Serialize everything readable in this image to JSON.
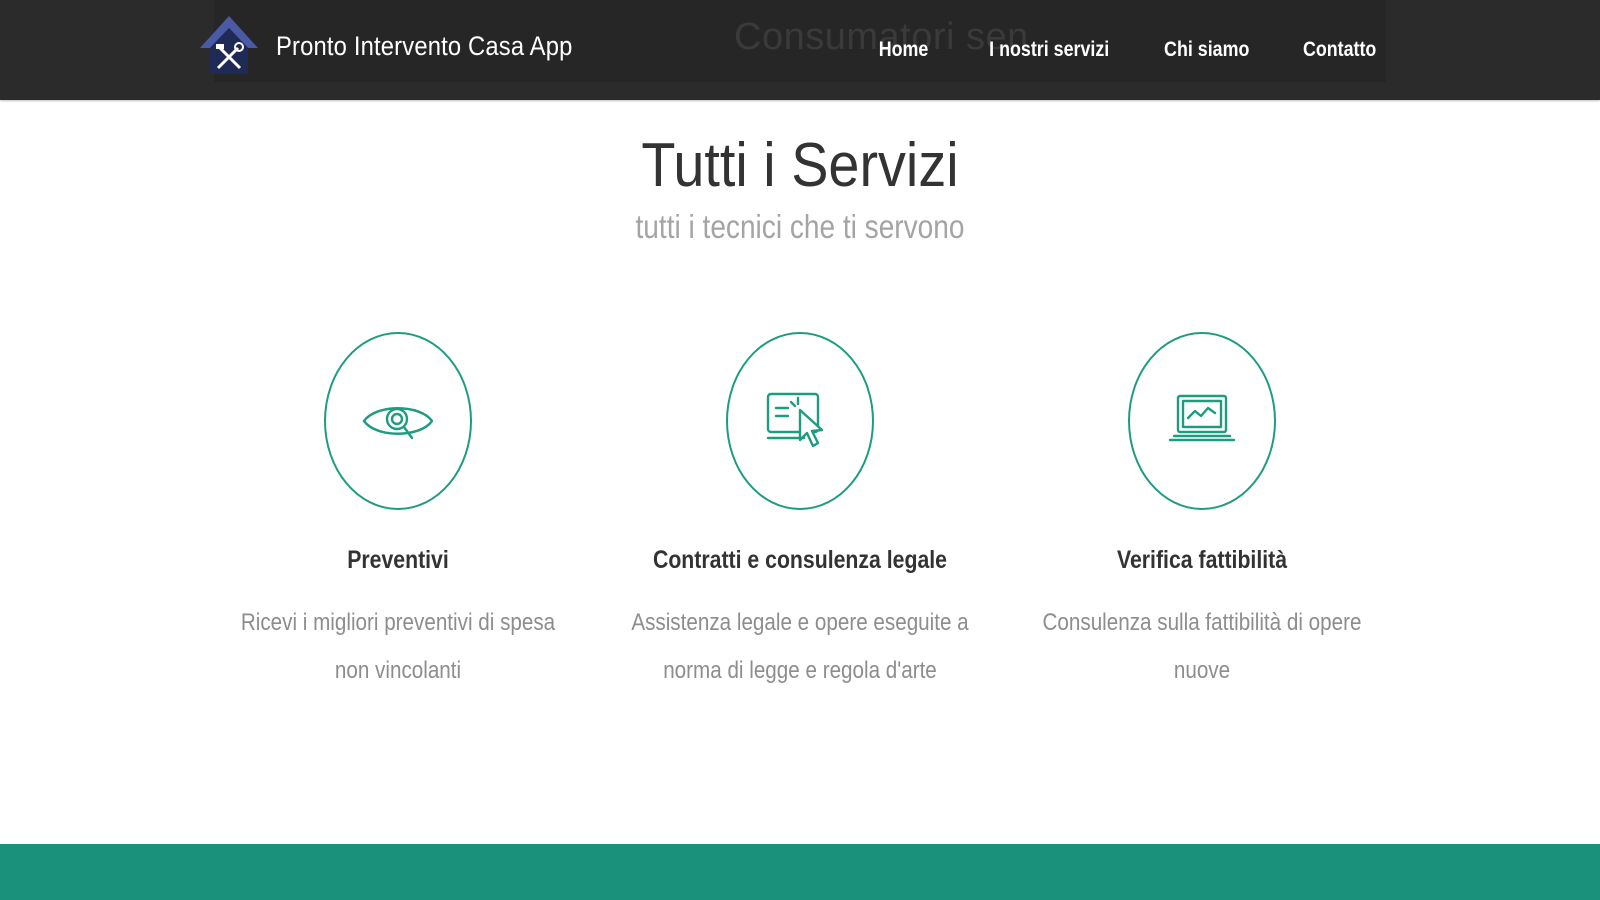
{
  "colors": {
    "navbar_bg": "#2b2b2b",
    "accent": "#1e9c80",
    "footer_band": "#1a917a",
    "title_text": "#333333",
    "muted_text": "#8d8d8d"
  },
  "navbar": {
    "brand_name": "Pronto Intervento Casa App",
    "logo_icon": "house-tools-icon",
    "background_text": "Consumatori sen",
    "links": [
      {
        "label": "Home"
      },
      {
        "label": "I nostri servizi"
      },
      {
        "label": "Chi siamo"
      },
      {
        "label": "Contatto"
      }
    ]
  },
  "main": {
    "title": "Tutti i Servizi",
    "subtitle": "tutti i tecnici che ti servono",
    "services": [
      {
        "icon": "eye-search-icon",
        "title": "Preventivi",
        "description": "Ricevi i migliori preventivi di spesa non vincolanti"
      },
      {
        "icon": "screen-cursor-icon",
        "title": "Contratti e consulenza legale",
        "description": "Assistenza legale e opere eseguite a norma di legge e regola d'arte"
      },
      {
        "icon": "laptop-chart-icon",
        "title": "Verifica fattibilità",
        "description": "Consulenza sulla fattibilità di opere nuove"
      }
    ]
  }
}
